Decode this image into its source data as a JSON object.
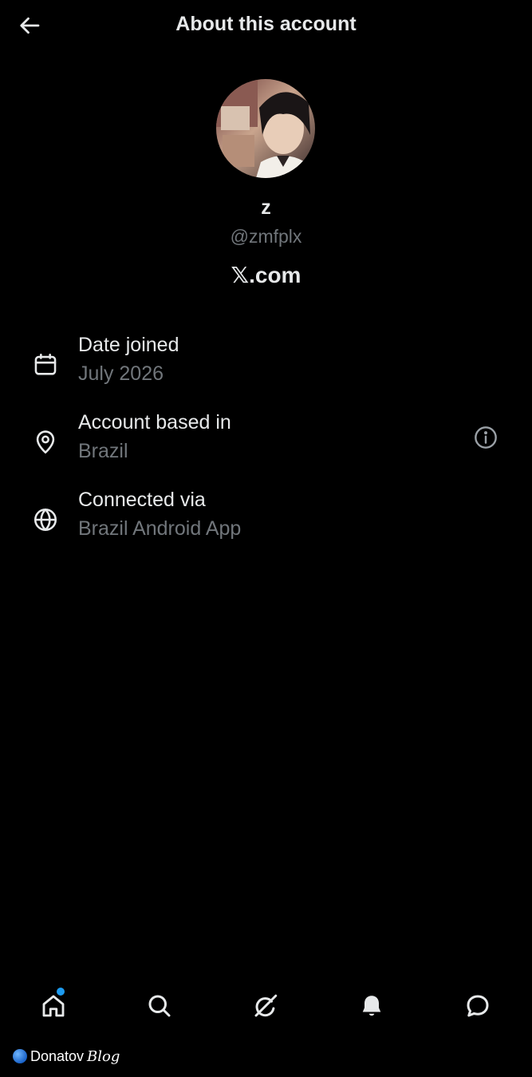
{
  "header": {
    "title": "About this account"
  },
  "profile": {
    "display_name": "z",
    "handle": "@zmfplx",
    "domain": "𝕏.com"
  },
  "details": [
    {
      "icon": "calendar-icon",
      "label": "Date joined",
      "value": "July 2026"
    },
    {
      "icon": "location-pin-icon",
      "label": "Account based in",
      "value": "Brazil"
    },
    {
      "icon": "globe-icon",
      "label": "Connected via",
      "value": "Brazil Android App"
    }
  ],
  "bottom_nav": {
    "items": [
      "home-icon",
      "search-icon",
      "grok-icon",
      "notifications-icon",
      "messages-icon"
    ],
    "notification_dot_color": "#1d9bf0"
  },
  "watermark": {
    "name": "Donatov",
    "suffix": "Blog"
  },
  "colors": {
    "background": "#000000",
    "primary_text": "#e7e9ea",
    "secondary_text": "#71767b",
    "accent": "#1d9bf0"
  }
}
